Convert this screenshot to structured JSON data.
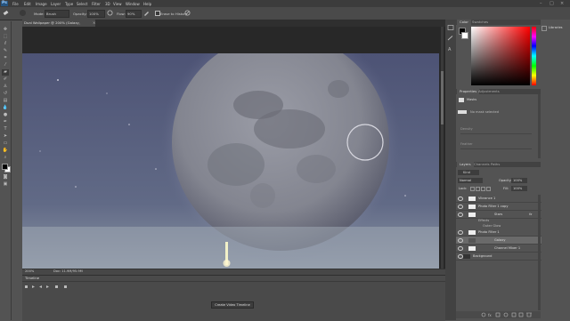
{
  "app": {
    "logo": "Ps"
  },
  "menu": [
    "File",
    "Edit",
    "Image",
    "Layer",
    "Type",
    "Select",
    "Filter",
    "3D",
    "View",
    "Window",
    "Help"
  ],
  "window_controls": {
    "minimize": "–",
    "maximize": "□",
    "close": "×"
  },
  "options": {
    "mode_label": "Mode:",
    "mode_value": "Brush",
    "opacity_label": "Opacity:",
    "opacity_value": "100%",
    "flow_label": "Flow:",
    "flow_value": "90%",
    "erase_history": "Erase to History"
  },
  "document": {
    "tab_title": "Dual Wallpaper @ 200% (Galaxy, RGB/8#) *",
    "zoom": "200%",
    "doc_info": "Doc: 11.9M/95.9M"
  },
  "timeline": {
    "title": "Timeline",
    "create_button": "Create Video Timeline"
  },
  "panels": {
    "color_tab": "Color",
    "swatches_tab": "Swatches",
    "libraries": "Libraries",
    "properties_tab": "Properties",
    "adjustments_tab": "Adjustments",
    "properties_title": "Masks",
    "no_mask": "No mask selected",
    "density_label": "Density",
    "feather_label": "Feather",
    "layers_tab": "Layers",
    "channels_tab": "Channels",
    "paths_tab": "Paths",
    "kind_label": "Kind",
    "blend_mode": "Normal",
    "opacity_label": "Opacity:",
    "opacity_value": "100%",
    "lock_label": "Lock:",
    "fill_label": "Fill:",
    "fill_value": "100%"
  },
  "layers": [
    {
      "name": "Vibrance 1",
      "fx": false
    },
    {
      "name": "Photo Filter 1 copy",
      "fx": false
    },
    {
      "name": "Stars",
      "fx": true
    },
    {
      "name": "Effects",
      "fx": false
    },
    {
      "name": "Outer Glow",
      "fx": false
    },
    {
      "name": "Photo Filter 1",
      "fx": false
    },
    {
      "name": "Galaxy",
      "fx": false
    },
    {
      "name": "Channel Mixer 1",
      "fx": false
    },
    {
      "name": "Background",
      "fx": false
    }
  ],
  "colors": {
    "ui_dark": "#535353",
    "panel_bg": "#535353",
    "accent": "#26537e",
    "selected_layer": "#6a6a6a"
  }
}
